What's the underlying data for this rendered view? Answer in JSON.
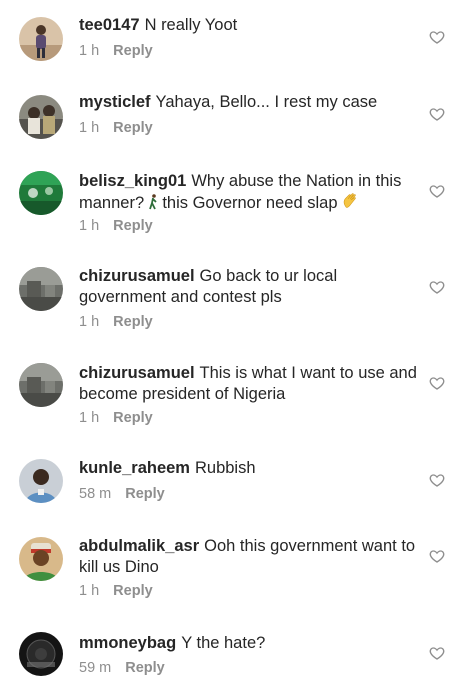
{
  "comments": [
    {
      "username": "tee0147",
      "text": "N really Yoot",
      "time": "1 h",
      "reply": "Reply",
      "avatar": "avatar-photo-person-standing"
    },
    {
      "username": "mysticlef",
      "text": "Yahaya, Bello... I rest my case",
      "time": "1 h",
      "reply": "Reply",
      "avatar": "avatar-photo-group"
    },
    {
      "username": "belisz_king01",
      "text": "Why abuse the Nation in this manner?",
      "text2": "this Governor need slap",
      "time": "1 h",
      "reply": "Reply",
      "avatar": "avatar-green-flag"
    },
    {
      "username": "chizurusamuel",
      "text": "Go back to ur local government and contest pls",
      "time": "1 h",
      "reply": "Reply",
      "avatar": "avatar-photo-outdoor"
    },
    {
      "username": "chizurusamuel",
      "text": "This is what I want to use and become president of Nigeria",
      "time": "1 h",
      "reply": "Reply",
      "avatar": "avatar-photo-outdoor"
    },
    {
      "username": "kunle_raheem",
      "text": "Rubbish",
      "time": "58 m",
      "reply": "Reply",
      "avatar": "avatar-photo-man"
    },
    {
      "username": "abdulmalik_asr",
      "text": "Ooh this government want to kill us",
      "text2": "Dino",
      "time": "1 h",
      "reply": "Reply",
      "avatar": "avatar-photo-man-cap"
    },
    {
      "username": "mmoneybag",
      "text": "Y the  hate?",
      "time": "59 m",
      "reply": "Reply",
      "avatar": "avatar-dark-logo"
    }
  ],
  "icons": {
    "like": "heart-outline-icon",
    "walking": "person-walking-emoji",
    "wave": "waving-hand-emoji"
  },
  "colors": {
    "text": "#262626",
    "meta": "#8e8e8e"
  }
}
